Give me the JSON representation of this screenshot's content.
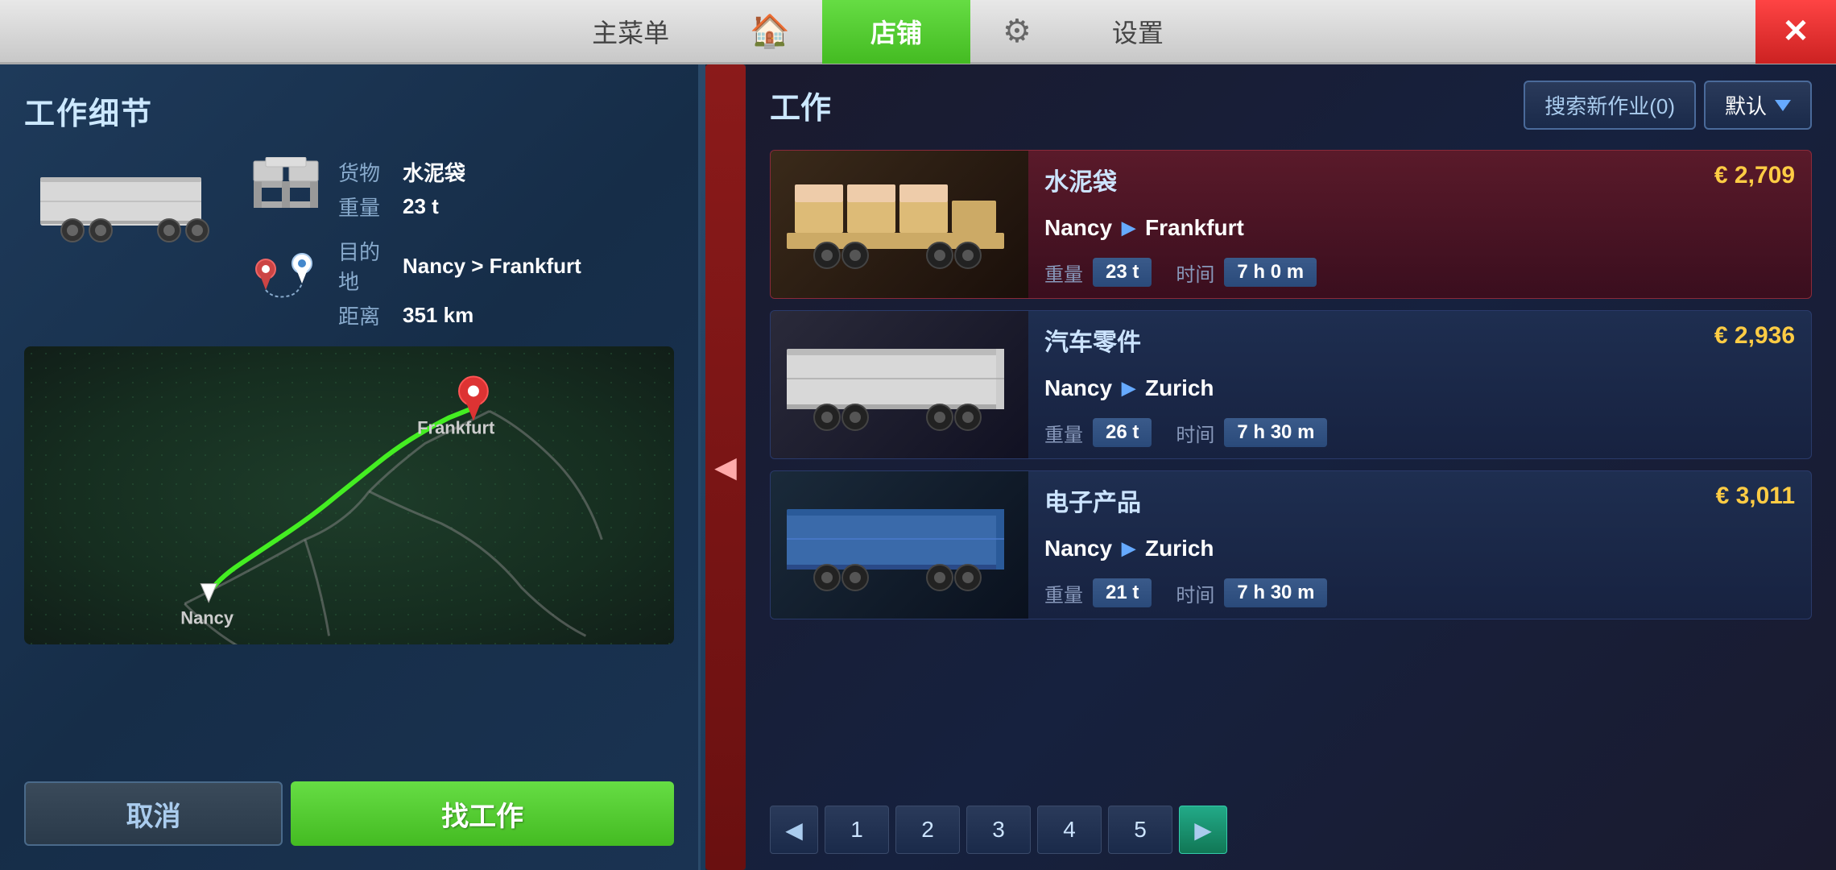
{
  "nav": {
    "main_menu": "主菜单",
    "home_icon": "🏠",
    "shop": "店铺",
    "settings_icon": "⚙",
    "settings": "设置",
    "close": "✕"
  },
  "left_panel": {
    "title": "工作细节",
    "cargo_label": "货物",
    "cargo_value": "水泥袋",
    "weight_label": "重量",
    "weight_value": "23 t",
    "destination_label": "目的地",
    "destination_value": "Nancy > Frankfurt",
    "distance_label": "距离",
    "distance_value": "351 km",
    "map": {
      "nancy_label": "Nancy",
      "frankfurt_label": "Frankfurt"
    },
    "btn_cancel": "取消",
    "btn_find_job": "找工作"
  },
  "right_panel": {
    "title": "工作",
    "search_new_label": "搜索新作业(0)",
    "default_label": "默认",
    "jobs": [
      {
        "cargo": "水泥袋",
        "price": "€ 2,709",
        "from": "Nancy",
        "to": "Frankfurt",
        "weight": "23 t",
        "time": "7 h 0 m",
        "weight_label": "重量",
        "time_label": "时间",
        "style": "card1"
      },
      {
        "cargo": "汽车零件",
        "price": "€ 2,936",
        "from": "Nancy",
        "to": "Zurich",
        "weight": "26 t",
        "time": "7 h 30 m",
        "weight_label": "重量",
        "time_label": "时间",
        "style": "card2"
      },
      {
        "cargo": "电子产品",
        "price": "€ 3,011",
        "from": "Nancy",
        "to": "Zurich",
        "weight": "21 t",
        "time": "7 h 30 m",
        "weight_label": "重量",
        "time_label": "时间",
        "style": "card3"
      }
    ],
    "pagination": {
      "pages": [
        "1",
        "2",
        "3",
        "4",
        "5"
      ]
    }
  }
}
